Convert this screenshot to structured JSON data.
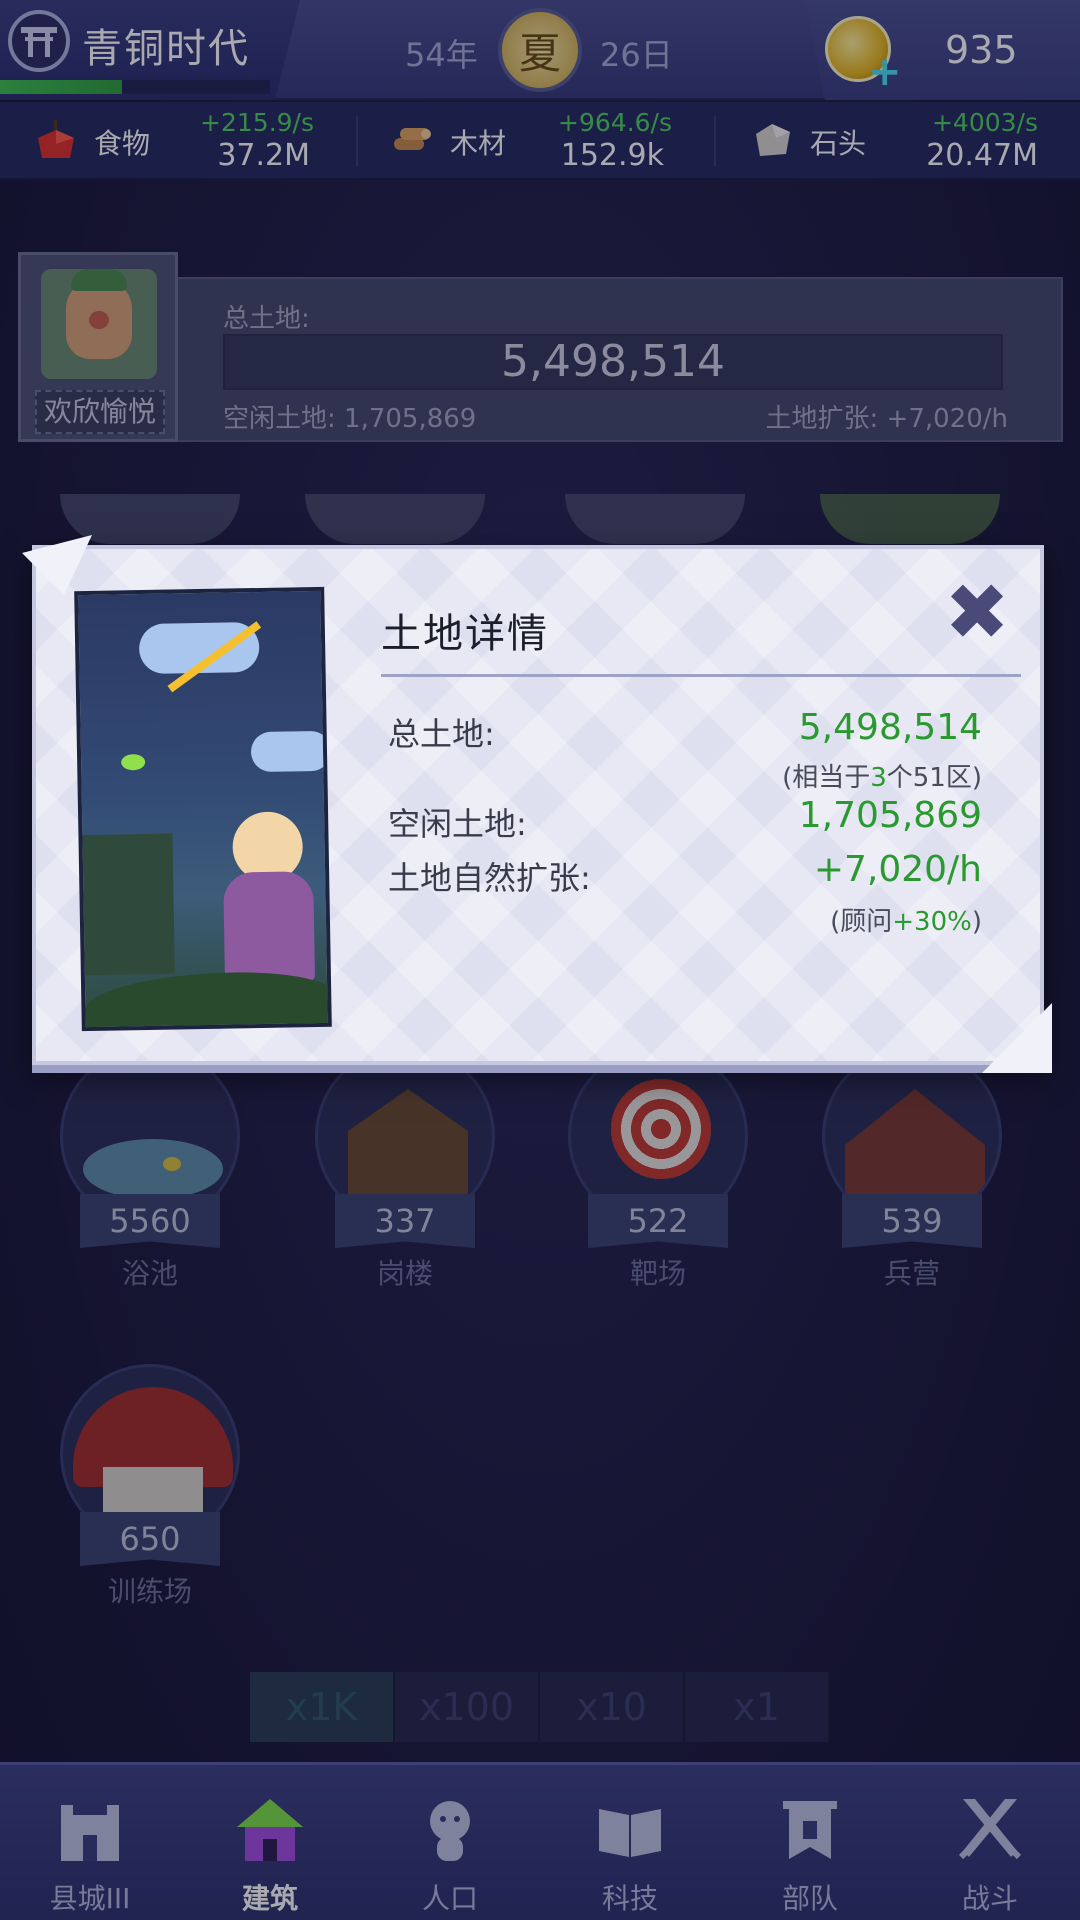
{
  "header": {
    "era_name": "青铜时代",
    "era_progress": 0.45,
    "year": "54年",
    "season": "夏",
    "day": "26日",
    "coins": "935"
  },
  "resources": [
    {
      "name": "食物",
      "rate": "+215.9/s",
      "amount": "37.2M",
      "icon": "apple-icon"
    },
    {
      "name": "木材",
      "rate": "+964.6/s",
      "amount": "152.9k",
      "icon": "wood-logs-icon"
    },
    {
      "name": "石头",
      "rate": "+4003/s",
      "amount": "20.47M",
      "icon": "stone-icon"
    }
  ],
  "land_summary": {
    "advisor_mood": "欢欣愉悦",
    "total_label": "总土地:",
    "total_value": "5,498,514",
    "idle_text": "空闲土地: 1,705,869",
    "expand_text": "土地扩张: +7,020/h"
  },
  "buildings": [
    {
      "count": "5560",
      "name": "浴池"
    },
    {
      "count": "337",
      "name": "岗楼"
    },
    {
      "count": "522",
      "name": "靶场"
    },
    {
      "count": "539",
      "name": "兵营"
    },
    {
      "count": "650",
      "name": "训练场"
    }
  ],
  "multipliers": [
    {
      "label": "x1K",
      "active": true
    },
    {
      "label": "x100",
      "active": false
    },
    {
      "label": "x10",
      "active": false
    },
    {
      "label": "x1",
      "active": false
    }
  ],
  "nav": [
    {
      "label": "县城III",
      "icon": "castle-icon"
    },
    {
      "label": "建筑",
      "icon": "house-icon",
      "active": true
    },
    {
      "label": "人口",
      "icon": "person-icon"
    },
    {
      "label": "科技",
      "icon": "book-icon"
    },
    {
      "label": "部队",
      "icon": "banner-icon"
    },
    {
      "label": "战斗",
      "icon": "crossed-swords-icon"
    }
  ],
  "modal": {
    "title": "土地详情",
    "close_symbol": "✖",
    "total_label": "总土地:",
    "total_value": "5,498,514",
    "total_note_prefix": "(相当于",
    "total_note_num": "3",
    "total_note_suffix": "个51区)",
    "idle_label": "空闲土地:",
    "idle_value": "1,705,869",
    "expand_label": "土地自然扩张:",
    "expand_value": "+7,020/h",
    "expand_note_prefix": "(顾问",
    "expand_note_bonus": "+30%",
    "expand_note_suffix": ")"
  },
  "colors": {
    "positive": "#2a9a30",
    "rate": "#4fd15f",
    "progress": "#3fc14f"
  }
}
